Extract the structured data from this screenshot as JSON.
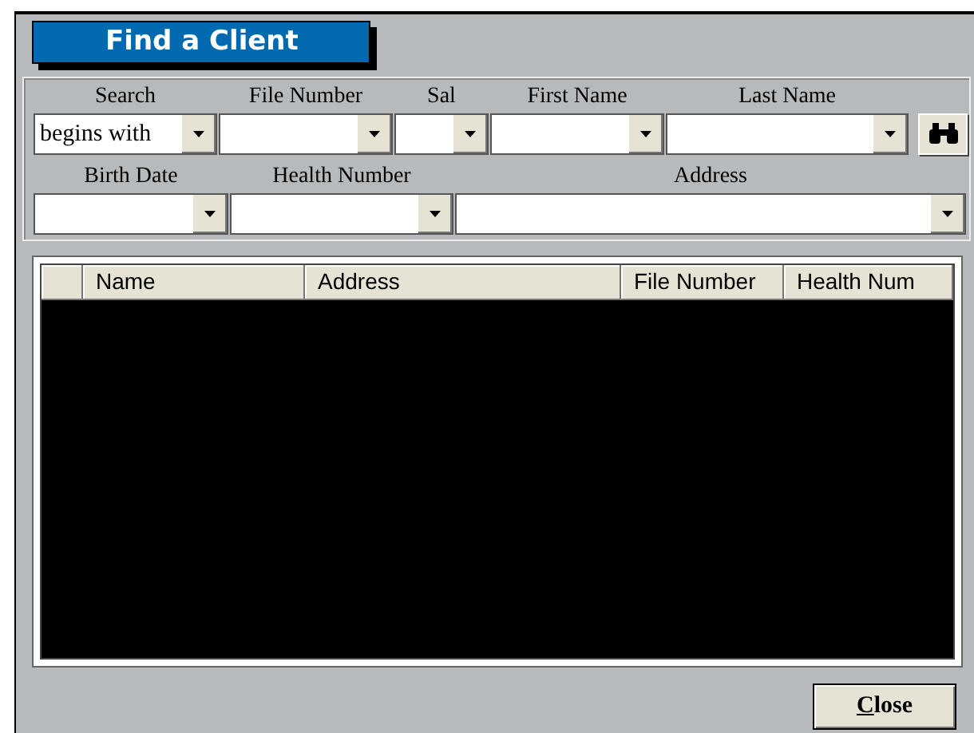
{
  "title": "Find a Client",
  "filter_rows": [
    [
      {
        "label": "Search",
        "value": "begins with"
      },
      {
        "label": "File Number"
      },
      {
        "label": "Sal"
      },
      {
        "label": "First Name"
      },
      {
        "label": "Last Name"
      }
    ],
    [
      {
        "label": "Birth Date"
      },
      {
        "label": "Health Number"
      },
      {
        "label": "Address"
      }
    ]
  ],
  "table": {
    "columns": [
      "Name",
      "Address",
      "File Number",
      "Health Num"
    ]
  },
  "buttons": [
    "Close"
  ]
}
